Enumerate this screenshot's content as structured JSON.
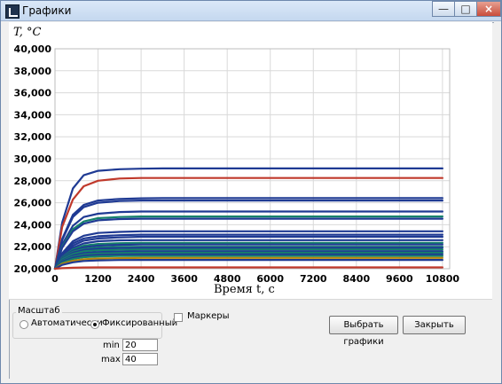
{
  "window": {
    "title": "Графики",
    "controls": {
      "minimize": "—",
      "maximize": "□",
      "close": "×"
    }
  },
  "chart": {
    "ylabel": "T, °C",
    "xlabel": "Время t, с",
    "yticks": [
      "40,000",
      "38,000",
      "36,000",
      "34,000",
      "32,000",
      "30,000",
      "28,000",
      "26,000",
      "24,000",
      "22,000",
      "20,000"
    ],
    "xticks": [
      "0",
      "1200",
      "2400",
      "3600",
      "4800",
      "6000",
      "7200",
      "8400",
      "9600",
      "10800"
    ]
  },
  "chart_data": {
    "type": "line",
    "xlabel": "Время t, с",
    "ylabel": "T, °C",
    "xlim": [
      0,
      11000
    ],
    "ylim": [
      20,
      40
    ],
    "x": [
      0,
      200,
      500,
      800,
      1200,
      1800,
      2400,
      3000,
      3600,
      4800,
      6000,
      7200,
      8400,
      9600,
      10800
    ],
    "grid": true,
    "series": [
      {
        "color": "#1f3a93",
        "values": [
          20.0,
          24.2,
          27.3,
          28.5,
          28.9,
          29.05,
          29.1,
          29.12,
          29.12,
          29.12,
          29.12,
          29.12,
          29.12,
          29.12,
          29.12
        ]
      },
      {
        "color": "#c0392b",
        "values": [
          20.0,
          23.8,
          26.3,
          27.5,
          28.0,
          28.2,
          28.25,
          28.25,
          28.25,
          28.25,
          28.25,
          28.25,
          28.25,
          28.25,
          28.25
        ]
      },
      {
        "color": "#1f3a93",
        "values": [
          20.0,
          22.7,
          24.9,
          25.8,
          26.2,
          26.35,
          26.4,
          26.42,
          26.42,
          26.42,
          26.42,
          26.42,
          26.42,
          26.42,
          26.42
        ]
      },
      {
        "color": "#1f3a93",
        "values": [
          20.0,
          22.6,
          24.7,
          25.6,
          26.0,
          26.15,
          26.2,
          26.2,
          26.2,
          26.2,
          26.2,
          26.2,
          26.2,
          26.2,
          26.2
        ]
      },
      {
        "color": "#1f3a93",
        "values": [
          20.0,
          22.2,
          23.9,
          24.7,
          25.0,
          25.15,
          25.2,
          25.2,
          25.2,
          25.2,
          25.2,
          25.2,
          25.2,
          25.2,
          25.2
        ]
      },
      {
        "color": "#16816b",
        "values": [
          20.0,
          22.0,
          23.6,
          24.3,
          24.6,
          24.7,
          24.75,
          24.75,
          24.75,
          24.75,
          24.75,
          24.75,
          24.75,
          24.75,
          24.75
        ]
      },
      {
        "color": "#1f3a93",
        "values": [
          20.0,
          21.9,
          23.4,
          24.1,
          24.4,
          24.52,
          24.55,
          24.55,
          24.55,
          24.55,
          24.55,
          24.55,
          24.55,
          24.55,
          24.55
        ]
      },
      {
        "color": "#1f3a93",
        "values": [
          20.0,
          21.4,
          22.5,
          23.0,
          23.25,
          23.35,
          23.4,
          23.4,
          23.4,
          23.4,
          23.4,
          23.4,
          23.4,
          23.4,
          23.4
        ]
      },
      {
        "color": "#1f3a93",
        "values": [
          20.0,
          21.3,
          22.3,
          22.75,
          22.95,
          23.05,
          23.1,
          23.1,
          23.1,
          23.1,
          23.1,
          23.1,
          23.1,
          23.1,
          23.1
        ]
      },
      {
        "color": "#1f3a93",
        "values": [
          20.0,
          21.2,
          22.1,
          22.55,
          22.75,
          22.85,
          22.9,
          22.9,
          22.9,
          22.9,
          22.9,
          22.9,
          22.9,
          22.9,
          22.9
        ]
      },
      {
        "color": "#1f3a93",
        "values": [
          20.0,
          21.1,
          21.9,
          22.3,
          22.5,
          22.58,
          22.6,
          22.6,
          22.6,
          22.6,
          22.6,
          22.6,
          22.6,
          22.6,
          22.6
        ]
      },
      {
        "color": "#16816b",
        "values": [
          20.0,
          21.05,
          21.75,
          22.1,
          22.25,
          22.32,
          22.35,
          22.35,
          22.35,
          22.35,
          22.35,
          22.35,
          22.35,
          22.35,
          22.35
        ]
      },
      {
        "color": "#1f3a93",
        "values": [
          20.0,
          21.0,
          21.65,
          21.95,
          22.1,
          22.17,
          22.2,
          22.2,
          22.2,
          22.2,
          22.2,
          22.2,
          22.2,
          22.2,
          22.2
        ]
      },
      {
        "color": "#16816b",
        "values": [
          20.0,
          20.95,
          21.55,
          21.8,
          21.93,
          21.98,
          22.0,
          22.0,
          22.0,
          22.0,
          22.0,
          22.0,
          22.0,
          22.0,
          22.0
        ]
      },
      {
        "color": "#1f3a93",
        "values": [
          20.0,
          20.9,
          21.45,
          21.7,
          21.82,
          21.87,
          21.9,
          21.9,
          21.9,
          21.9,
          21.9,
          21.9,
          21.9,
          21.9,
          21.9
        ]
      },
      {
        "color": "#16816b",
        "values": [
          20.0,
          20.85,
          21.35,
          21.58,
          21.68,
          21.72,
          21.75,
          21.75,
          21.75,
          21.75,
          21.75,
          21.75,
          21.75,
          21.75,
          21.75
        ]
      },
      {
        "color": "#1f3a93",
        "values": [
          20.0,
          20.75,
          21.2,
          21.42,
          21.52,
          21.56,
          21.58,
          21.58,
          21.58,
          21.58,
          21.58,
          21.58,
          21.58,
          21.58,
          21.58
        ]
      },
      {
        "color": "#16816b",
        "values": [
          20.0,
          20.7,
          21.1,
          21.3,
          21.38,
          21.42,
          21.45,
          21.45,
          21.45,
          21.45,
          21.45,
          21.45,
          21.45,
          21.45,
          21.45
        ]
      },
      {
        "color": "#1f3a93",
        "values": [
          20.0,
          20.65,
          21.0,
          21.18,
          21.25,
          21.28,
          21.3,
          21.3,
          21.3,
          21.3,
          21.3,
          21.3,
          21.3,
          21.3,
          21.3
        ]
      },
      {
        "color": "#16816b",
        "values": [
          20.0,
          20.55,
          20.88,
          21.05,
          21.12,
          21.15,
          21.15,
          21.15,
          21.15,
          21.15,
          21.15,
          21.15,
          21.15,
          21.15,
          21.15
        ]
      },
      {
        "color": "#b8860b",
        "values": [
          20.0,
          20.45,
          20.72,
          20.86,
          20.93,
          20.96,
          20.98,
          20.98,
          20.98,
          20.98,
          20.98,
          20.98,
          20.98,
          20.98,
          20.98
        ]
      },
      {
        "color": "#1f3a93",
        "values": [
          20.0,
          20.35,
          20.58,
          20.7,
          20.76,
          20.79,
          20.8,
          20.8,
          20.8,
          20.8,
          20.8,
          20.8,
          20.8,
          20.8,
          20.8
        ]
      },
      {
        "color": "#c0392b",
        "values": [
          20.0,
          20.05,
          20.09,
          20.11,
          20.12,
          20.12,
          20.12,
          20.12,
          20.12,
          20.12,
          20.12,
          20.12,
          20.12,
          20.12,
          20.12
        ]
      }
    ]
  },
  "scale": {
    "group_label": "Масштаб",
    "auto_label": "Автоматически",
    "fixed_label": "Фиксированный",
    "fixed_selected": true,
    "min_label": "min",
    "min_value": "20",
    "max_label": "max",
    "max_value": "40"
  },
  "markers": {
    "label": "Маркеры",
    "checked": false
  },
  "buttons": {
    "select": "Выбрать графики",
    "close": "Закрыть"
  }
}
